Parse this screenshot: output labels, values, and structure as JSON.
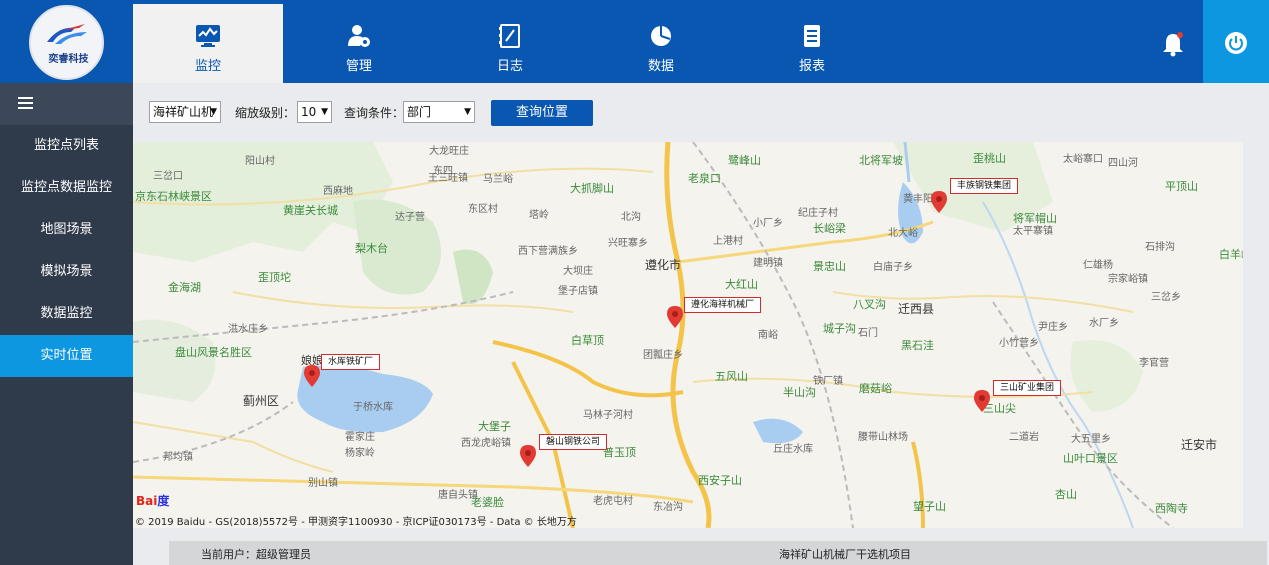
{
  "logo": {
    "text": "奕睿科技"
  },
  "nav": {
    "tabs": [
      {
        "label": "监控",
        "icon": "monitor-icon",
        "active": true
      },
      {
        "label": "管理",
        "icon": "user-gear-icon",
        "active": false
      },
      {
        "label": "日志",
        "icon": "log-icon",
        "active": false
      },
      {
        "label": "数据",
        "icon": "pie-chart-icon",
        "active": false
      },
      {
        "label": "报表",
        "icon": "report-icon",
        "active": false
      }
    ],
    "notifications_icon": "bell-icon",
    "power_icon": "power-icon"
  },
  "sidebar": {
    "items": [
      {
        "label": "监控点列表",
        "active": false
      },
      {
        "label": "监控点数据监控",
        "active": false
      },
      {
        "label": "地图场景",
        "active": false
      },
      {
        "label": "模拟场景",
        "active": false
      },
      {
        "label": "数据监控",
        "active": false
      },
      {
        "label": "实时位置",
        "active": true
      }
    ]
  },
  "toolbar": {
    "project_select": "海祥矿山机",
    "zoom_label": "缩放级别：",
    "zoom_value": "10",
    "query_label": "查询条件：",
    "query_value": "部门",
    "query_button": "查询位置"
  },
  "map": {
    "markers": [
      {
        "label": "丰族钢铁集团"
      },
      {
        "label": "遵化海祥机械厂"
      },
      {
        "label": "水厍铁矿厂"
      },
      {
        "label": "三山矿业集团"
      },
      {
        "label": "磐山钢铁公司"
      }
    ],
    "places": [
      "阳山村",
      "东四",
      "三岔口",
      "大龙旺庄",
      "马兰峪",
      "北将军坡",
      "歪桃山",
      "太峪寨口",
      "西麻地",
      "王三旺镇",
      "鹭峰山",
      "大抓脚山",
      "小厂乡",
      "四山河",
      "平顶山",
      "京东石林峡景区",
      "黄崖关长城",
      "达子营",
      "东区村",
      "塔岭",
      "北沟",
      "老泉口",
      "黄丰阳",
      "北大峪",
      "将军帽山",
      "梨木台",
      "西下营满族乡",
      "兴旺寨乡",
      "上港村",
      "长峪梁",
      "纪庄子村",
      "太平寨镇",
      "石排沟",
      "歪顶坨",
      "金海湖",
      "遵化市",
      "大红山",
      "建明镇",
      "景忠山",
      "白庙子乡",
      "白羊峪",
      "仁雄杨",
      "堡子店镇",
      "宗家峪镇",
      "三岔乡",
      "洪水庄乡",
      "八叉沟",
      "迁西县",
      "尹庄乡",
      "水厂乡",
      "娘娘林",
      "大坝庄",
      "南峪",
      "城子沟",
      "石门",
      "黑石洼",
      "盘山风景名胜区",
      "白草顶",
      "团瓢庄乡",
      "小竹营乡",
      "李官营",
      "蓟州区",
      "五风山",
      "铁厂镇",
      "半山沟",
      "磨菇峪",
      "三山尖",
      "邦均镇",
      "于桥水库",
      "霍家庄",
      "大堡子",
      "马林子河村",
      "丘庄水库",
      "腰带山林场",
      "二道岩",
      "大五里乡",
      "迁安市",
      "杨家岭",
      "西龙虎峪镇",
      "普玉顶",
      "西安子山",
      "山叶口景区",
      "别山镇",
      "唐自头镇",
      "老婆脸",
      "老虎屯村",
      "东冶沟",
      "望子山",
      "杏山",
      "西陶寺"
    ],
    "copyright": "© 2019 Baidu - GS(2018)5572号 - 甲测资字1100930 - 京ICP证030173号 - Data © 长地万方"
  },
  "status": {
    "user": "当前用户：超级管理员",
    "project": "海祥矿山机械厂干选机项目"
  },
  "colors": {
    "primary": "#0a57b1",
    "accent": "#0e97e1",
    "sidebar": "#2f3a4b",
    "pin": "#e23b33"
  }
}
